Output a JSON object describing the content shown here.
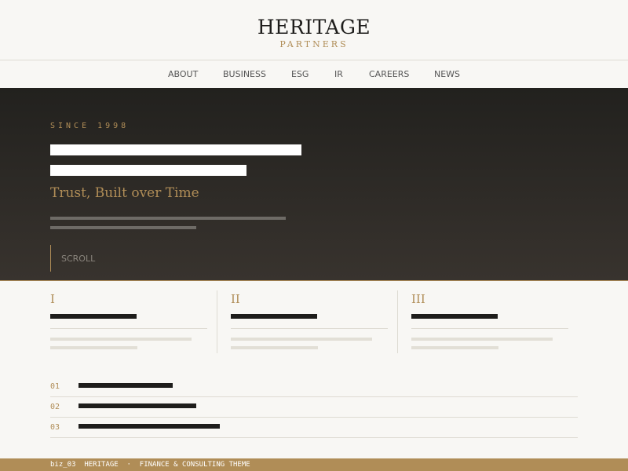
{
  "brand": {
    "title": "HERITAGE",
    "subtitle": "PARTNERS"
  },
  "nav": {
    "items": [
      "ABOUT",
      "BUSINESS",
      "ESG",
      "IR",
      "CAREERS",
      "NEWS"
    ]
  },
  "hero": {
    "eyebrow": "SINCE 1998",
    "tagline": "Trust, Built over Time",
    "scroll_label": "SCROLL"
  },
  "features": {
    "items": [
      {
        "numeral": "I"
      },
      {
        "numeral": "II"
      },
      {
        "numeral": "III"
      }
    ]
  },
  "list": {
    "items": [
      {
        "num": "01"
      },
      {
        "num": "02"
      },
      {
        "num": "03"
      }
    ]
  },
  "footer": {
    "text": "biz_03  HERITAGE  ·  FINANCE & CONSULTING THEME"
  },
  "colors": {
    "accent": "#b08d57",
    "dark": "#1e1d1b",
    "background": "#f8f7f4"
  }
}
